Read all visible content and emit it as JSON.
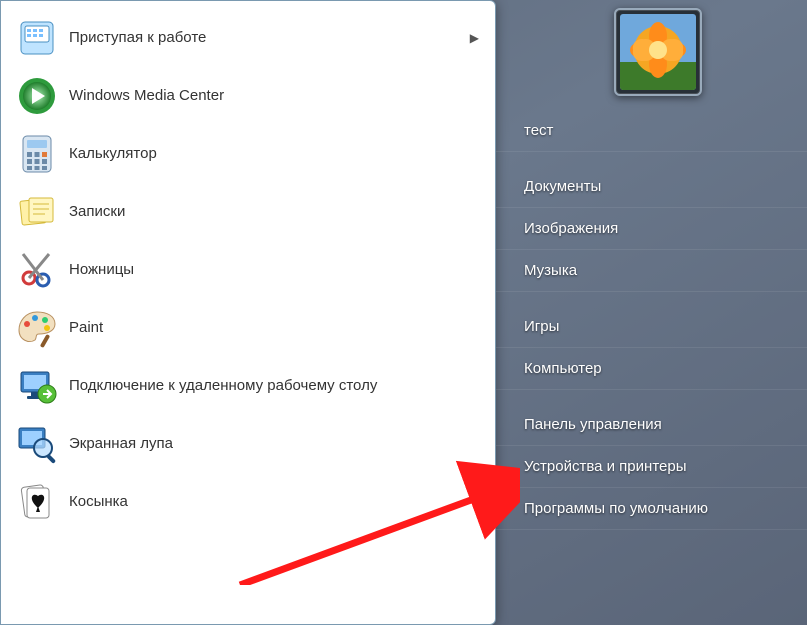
{
  "left_panel": {
    "programs": [
      {
        "label": "Приступая к работе",
        "icon": "getting-started-icon",
        "has_submenu": true
      },
      {
        "label": "Windows Media Center",
        "icon": "media-center-icon",
        "has_submenu": false
      },
      {
        "label": "Калькулятор",
        "icon": "calculator-icon",
        "has_submenu": false
      },
      {
        "label": "Записки",
        "icon": "sticky-notes-icon",
        "has_submenu": false
      },
      {
        "label": "Ножницы",
        "icon": "snipping-tool-icon",
        "has_submenu": false
      },
      {
        "label": "Paint",
        "icon": "paint-icon",
        "has_submenu": false
      },
      {
        "label": "Подключение к удаленному рабочему столу",
        "icon": "remote-desktop-icon",
        "has_submenu": false
      },
      {
        "label": "Экранная лупа",
        "icon": "magnifier-icon",
        "has_submenu": false
      },
      {
        "label": "Косынка",
        "icon": "solitaire-icon",
        "has_submenu": false
      }
    ],
    "submenu_arrow_glyph": "▶"
  },
  "right_panel": {
    "items": [
      {
        "label": "тест",
        "group": 0
      },
      {
        "label": "Документы",
        "group": 1
      },
      {
        "label": "Изображения",
        "group": 1
      },
      {
        "label": "Музыка",
        "group": 1
      },
      {
        "label": "Игры",
        "group": 2
      },
      {
        "label": "Компьютер",
        "group": 2
      },
      {
        "label": "Панель управления",
        "group": 3
      },
      {
        "label": "Устройства и принтеры",
        "group": 3
      },
      {
        "label": "Программы по умолчанию",
        "group": 3
      }
    ]
  },
  "avatar": {
    "name": "user-avatar-flower"
  },
  "annotation_arrow": {
    "color": "#ff1a1a"
  }
}
